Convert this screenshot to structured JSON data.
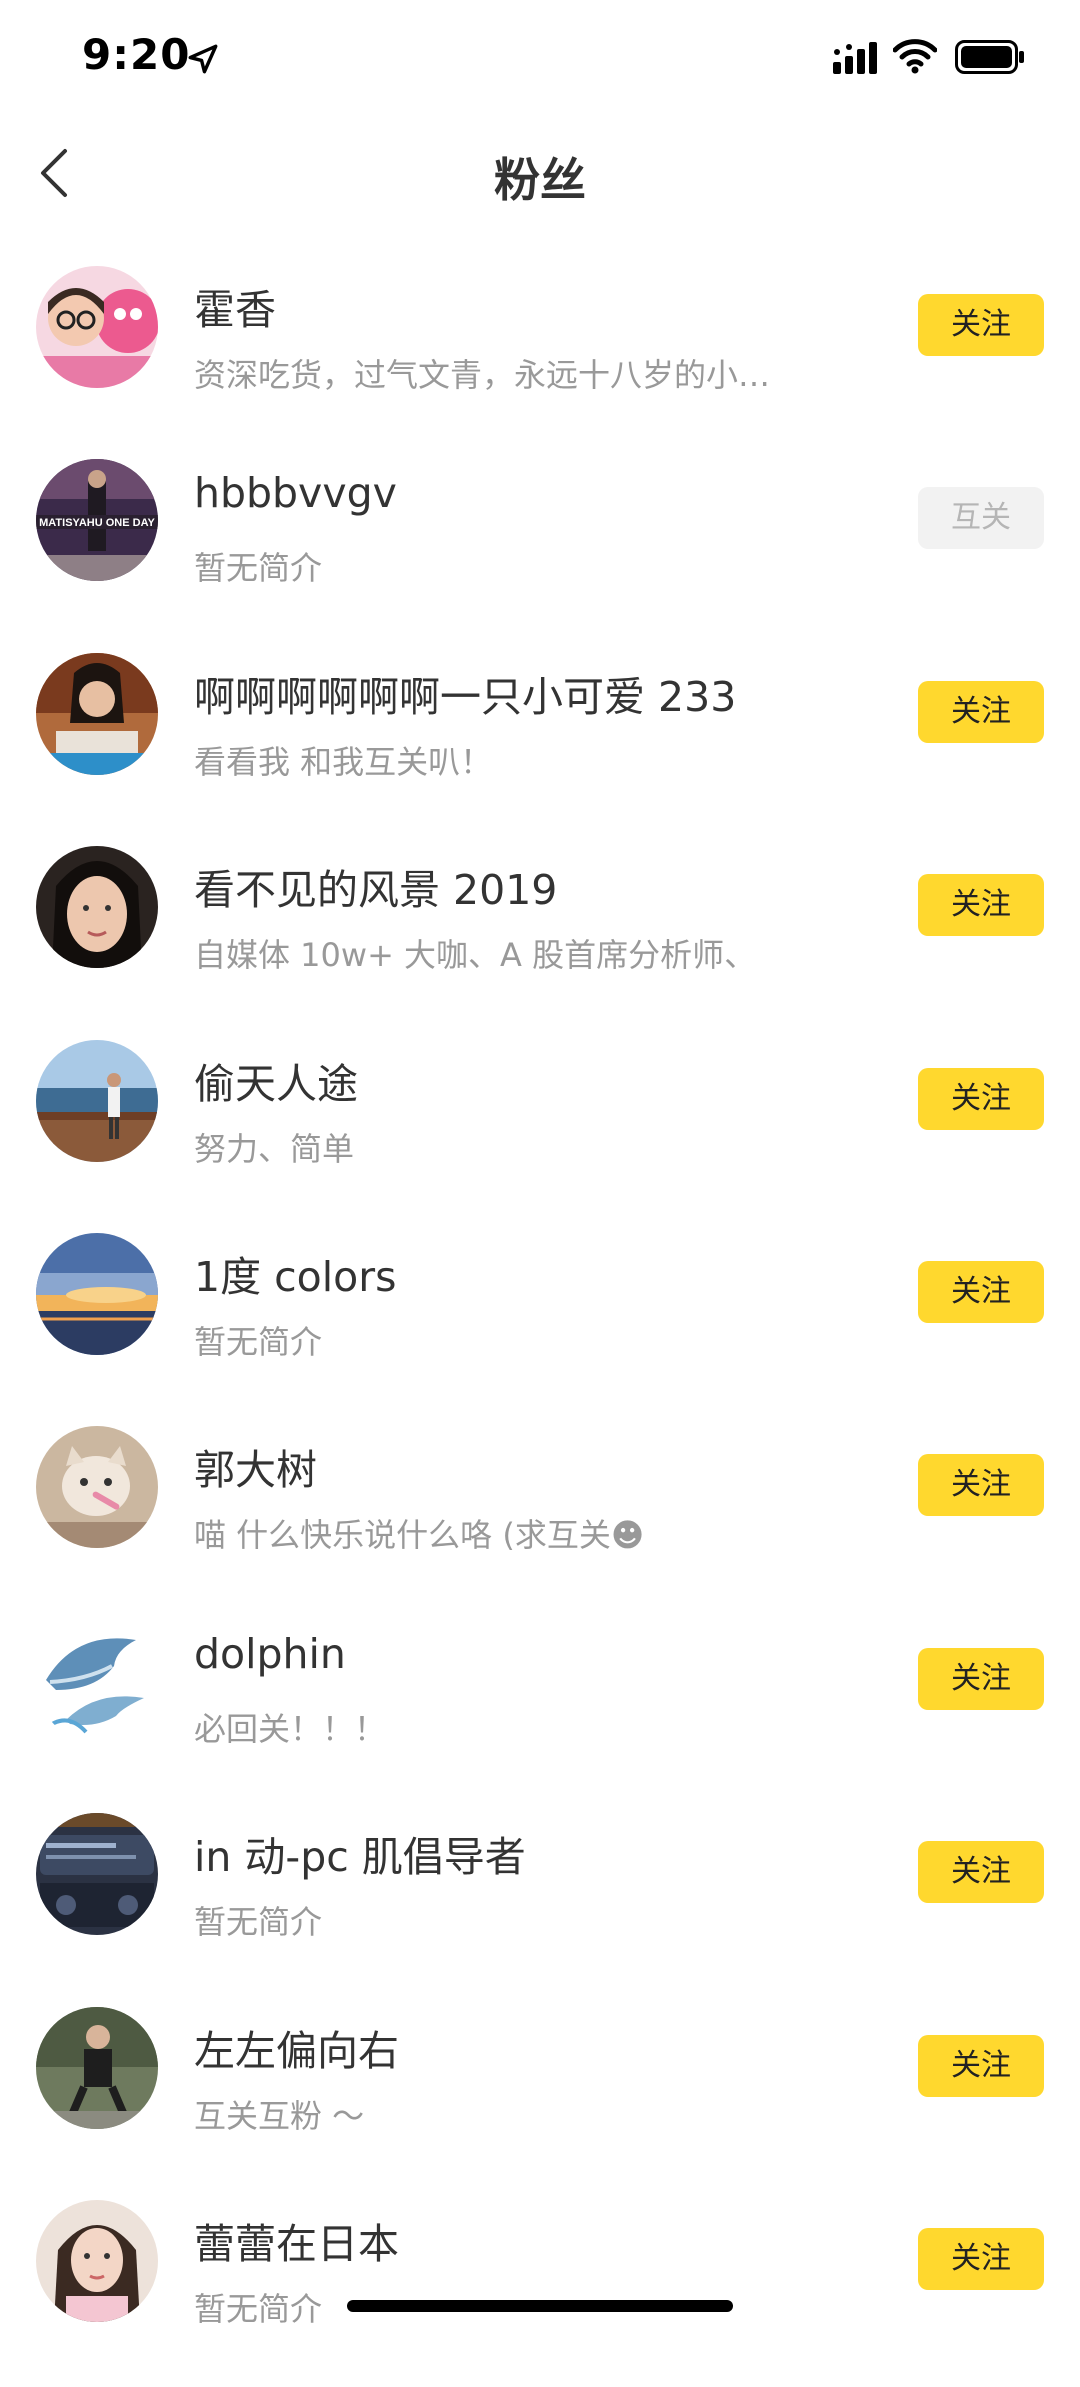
{
  "status_bar": {
    "time": "9:20"
  },
  "header": {
    "title": "粉丝"
  },
  "fans": [
    {
      "name": "霍香",
      "bio": "资深吃货，过气文青，永远十八岁的小…",
      "action": "关注",
      "mutual": false
    },
    {
      "name": "hbbbvvgv",
      "bio": "暂无简介",
      "action": "互关",
      "mutual": true
    },
    {
      "name": "啊啊啊啊啊啊一只小可爱 233",
      "bio": "看看我 和我互关叭！",
      "action": "关注",
      "mutual": false
    },
    {
      "name": "看不见的风景 2019",
      "bio": "自媒体 10w+ 大咖、A 股首席分析师、",
      "action": "关注",
      "mutual": false
    },
    {
      "name": "偷天人途",
      "bio": "努力、简单",
      "action": "关注",
      "mutual": false
    },
    {
      "name": "1度 colors",
      "bio": "暂无简介",
      "action": "关注",
      "mutual": false
    },
    {
      "name": "郭大树",
      "bio": "喵 什么快乐说什么咯 (求互关☻",
      "action": "关注",
      "mutual": false
    },
    {
      "name": "dolphin",
      "bio": "必回关！！！",
      "action": "关注",
      "mutual": false
    },
    {
      "name": "in 动-pc 肌倡导者",
      "bio": "暂无简介",
      "action": "关注",
      "mutual": false
    },
    {
      "name": "左左偏向右",
      "bio": "互关互粉 ～",
      "action": "关注",
      "mutual": false
    },
    {
      "name": "蕾蕾在日本",
      "bio": "暂无简介",
      "action": "关注",
      "mutual": false
    }
  ],
  "colors": {
    "follow_button": "#FFD82E",
    "mutual_button": "#F2F2F2",
    "name_text": "#333333",
    "bio_text": "#999999"
  },
  "icons": {
    "back": "chevron-left-icon",
    "location": "location-arrow-icon",
    "signal": "cellular-signal-icon",
    "wifi": "wifi-icon",
    "battery": "battery-icon"
  }
}
